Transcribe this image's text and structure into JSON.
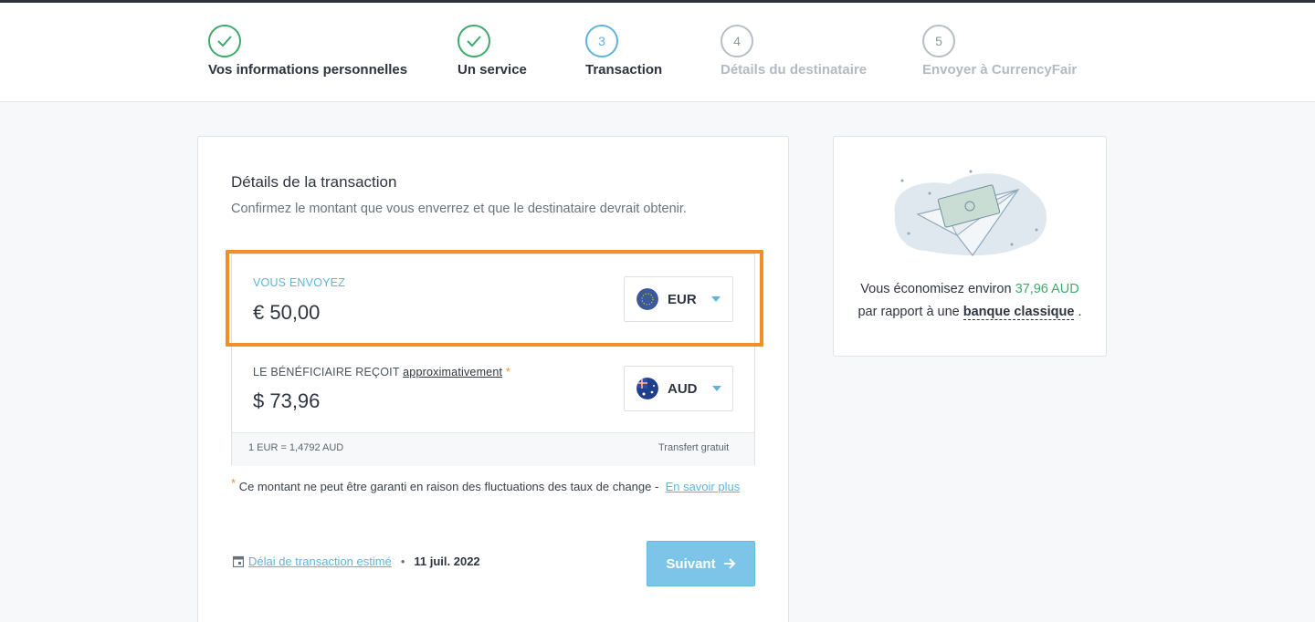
{
  "steps": [
    {
      "number": "1",
      "label": "Vos informations personnelles",
      "state": "done"
    },
    {
      "number": "2",
      "label": "Un service",
      "state": "done"
    },
    {
      "number": "3",
      "label": "Transaction",
      "state": "active"
    },
    {
      "number": "4",
      "label": "Détails du destinataire",
      "state": "upcoming"
    },
    {
      "number": "5",
      "label": "Envoyer à CurrencyFair",
      "state": "upcoming"
    }
  ],
  "transaction": {
    "title": "Détails de la transaction",
    "subtitle": "Confirmez le montant que vous enverrez et que le destinataire devrait obtenir.",
    "send": {
      "label": "VOUS ENVOYEZ",
      "amount": "€ 50,00",
      "currency": "EUR"
    },
    "receive": {
      "label": "LE BÉNÉFICIAIRE REÇOIT",
      "label_link": "approximativement",
      "star": "*",
      "amount": "$ 73,96",
      "currency": "AUD"
    },
    "rate": "1 EUR = 1,4792 AUD",
    "fee": "Transfert gratuit",
    "disclaimer_star": "*",
    "disclaimer": "Ce montant ne peut être garanti en raison des fluctuations des taux de change -",
    "learn_more": "En savoir plus",
    "eta_link": "Délai de transaction estimé",
    "eta_sep": "•",
    "eta_date": "11 juil. 2022",
    "next_label": "Suivant"
  },
  "savings": {
    "prefix": "Vous économisez environ",
    "amount": "37,96 AUD",
    "middle": "par rapport à une",
    "bank": "banque classique",
    "suffix": "."
  },
  "colors": {
    "accent": "#5eb5dc",
    "success": "#3cab6a",
    "highlight": "#f18f26"
  }
}
